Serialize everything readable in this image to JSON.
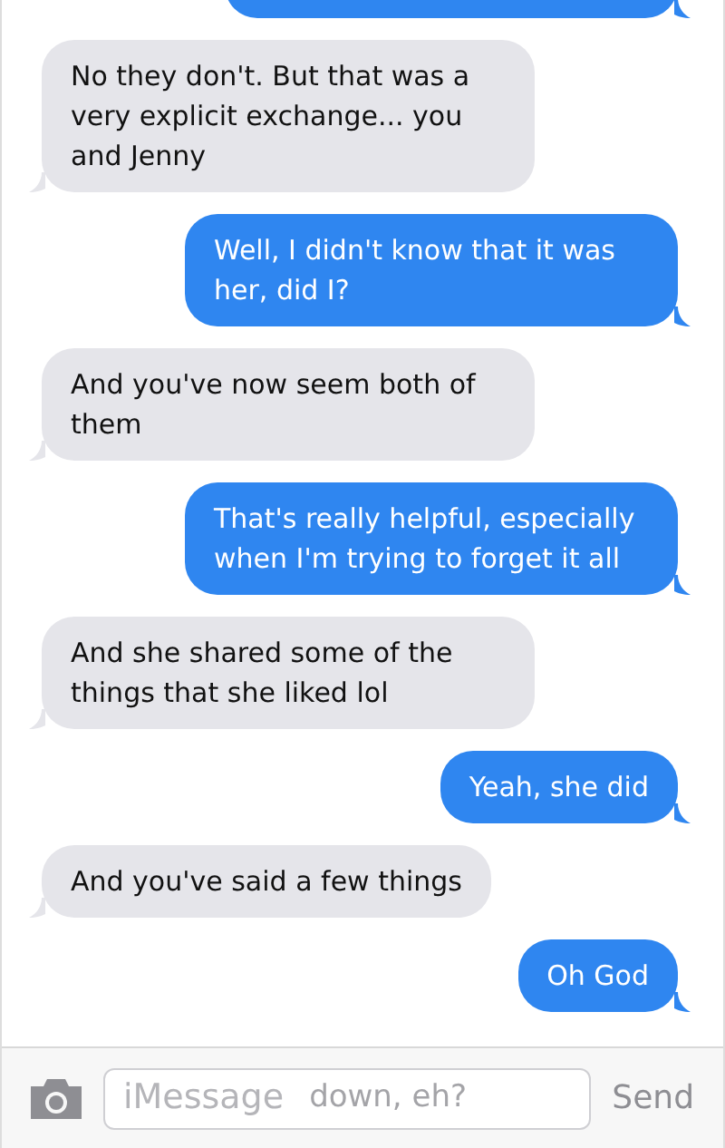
{
  "top_partial_bubble": {
    "kind": "sent"
  },
  "messages": [
    {
      "kind": "received",
      "text": "No they don't. But that was a very explicit exchange... you and Jenny"
    },
    {
      "kind": "sent",
      "text": "Well, I didn't know that it was her, did I?"
    },
    {
      "kind": "received",
      "text": "And you've now seem both of them"
    },
    {
      "kind": "sent",
      "text": "That's really helpful, especially when I'm trying to forget it all"
    },
    {
      "kind": "received",
      "text": "And she shared some of the things that she liked lol"
    },
    {
      "kind": "sent",
      "text": "Yeah, she did"
    },
    {
      "kind": "received",
      "text": "And you've said a few things"
    },
    {
      "kind": "sent",
      "text": "Oh God"
    }
  ],
  "composer": {
    "placeholder": "iMessage",
    "ghost_text": "down, eh?",
    "send": "Send"
  }
}
